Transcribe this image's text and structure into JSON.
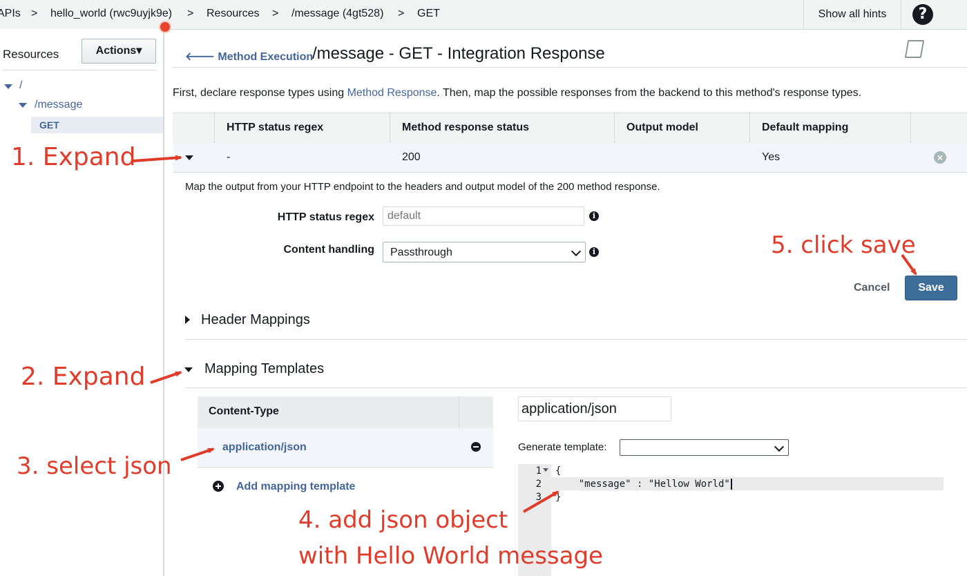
{
  "breadcrumb": {
    "items": [
      "APIs",
      "hello_world (rwc9uyjk9e)",
      "Resources",
      "/message (4gt528)",
      "GET"
    ],
    "separator": ">"
  },
  "topbar": {
    "hints_label": "Show all hints",
    "help_glyph": "?"
  },
  "sidebar": {
    "title": "Resources",
    "actions_label": "Actions",
    "actions_caret": "▾",
    "tree": {
      "root": "/",
      "child": "/message",
      "method": "GET"
    }
  },
  "header": {
    "back_arrow": "🡐",
    "back_label": "Method Execution",
    "title": "/message - GET - Integration Response"
  },
  "intro": {
    "prefix": "First, declare response types using ",
    "link": "Method Response",
    "suffix": ". Then, map the possible responses from the backend to this method's response types."
  },
  "responses_table": {
    "headers": [
      "HTTP status regex",
      "Method response status",
      "Output model",
      "Default mapping"
    ],
    "row": {
      "regex": "-",
      "status": "200",
      "model": "",
      "default": "Yes",
      "remove_glyph": "×"
    }
  },
  "mapping": {
    "description": "Map the output from your HTTP endpoint to the headers and output model of the 200 method response.",
    "regex_label": "HTTP status regex",
    "regex_placeholder": "default",
    "handling_label": "Content handling",
    "handling_value": "Passthrough",
    "info_glyph": "i"
  },
  "actions": {
    "cancel_label": "Cancel",
    "save_label": "Save"
  },
  "sections": {
    "header_mappings": "Header Mappings",
    "mapping_templates": "Mapping Templates"
  },
  "templates": {
    "column_header": "Content-Type",
    "selected": "application/json",
    "add_label": "Add mapping template",
    "content_type_value": "application/json",
    "generate_label": "Generate template:"
  },
  "editor": {
    "lines": [
      {
        "n": "1",
        "text": "{"
      },
      {
        "n": "2",
        "text": "    \"message\" : \"Hellow World\""
      },
      {
        "n": "3",
        "text": "}"
      }
    ]
  },
  "annotations": {
    "step1": "1. Expand",
    "step2": "2. Expand",
    "step3": "3. select json",
    "step4a": "4. add json object",
    "step4b": "with Hello World message",
    "step5": "5. click save",
    "color": "#e03c2b"
  },
  "colors": {
    "link": "#44659a",
    "primary": "#3d6d99",
    "header_bg": "#f2f3f3"
  }
}
